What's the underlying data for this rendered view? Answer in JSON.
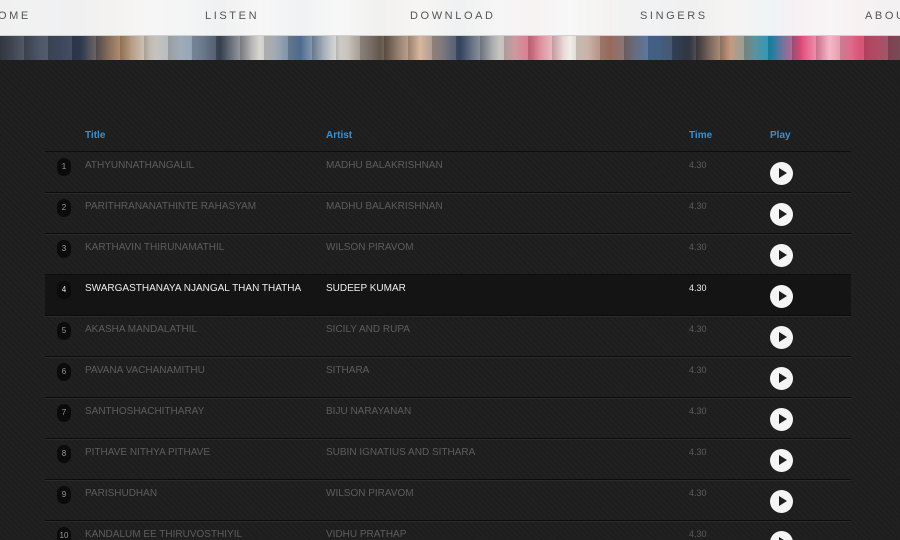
{
  "nav": {
    "items": [
      {
        "label": "OME"
      },
      {
        "label": "LISTEN"
      },
      {
        "label": "DOWNLOAD"
      },
      {
        "label": "SINGERS"
      },
      {
        "label": "ABOU"
      }
    ]
  },
  "table": {
    "headers": {
      "title": "Title",
      "artist": "Artist",
      "time": "Time",
      "play": "Play"
    },
    "rows": [
      {
        "num": "1",
        "title": "ATHYUNNATHANGALIL",
        "artist": "MADHU BALAKRISHNAN",
        "time": "4.30"
      },
      {
        "num": "2",
        "title": "PARITHRANANATHINTE RAHASYAM",
        "artist": "MADHU BALAKRISHNAN",
        "time": "4.30"
      },
      {
        "num": "3",
        "title": "KARTHAVIN THIRUNAMATHIL",
        "artist": "WILSON PIRAVOM",
        "time": "4.30"
      },
      {
        "num": "4",
        "title": "SWARGASTHANAYA NJANGAL THAN THATHA",
        "artist": "SUDEEP KUMAR",
        "time": "4.30",
        "active": true
      },
      {
        "num": "5",
        "title": "AKASHA MANDALATHIL",
        "artist": "SICILY AND RUPA",
        "time": "4.30"
      },
      {
        "num": "6",
        "title": "PAVANA VACHANAMITHU",
        "artist": "SITHARA",
        "time": "4.30"
      },
      {
        "num": "7",
        "title": "SANTHOSHACHITHARAY",
        "artist": "BIJU NARAYANAN",
        "time": "4.30"
      },
      {
        "num": "8",
        "title": "PITHAVE NITHYA PITHAVE",
        "artist": "SUBIN IGNATIUS AND SITHARA",
        "time": "4.30"
      },
      {
        "num": "9",
        "title": "PARISHUDHAN",
        "artist": "WILSON PIRAVOM",
        "time": "4.30"
      },
      {
        "num": "10",
        "title": "KANDALUM EE THIRUVOSTHIYIL",
        "artist": "VIDHU PRATHAP",
        "time": "4.30"
      }
    ]
  },
  "colors": {
    "accent": "#3b8fd1",
    "background": "#1e1e1e"
  }
}
